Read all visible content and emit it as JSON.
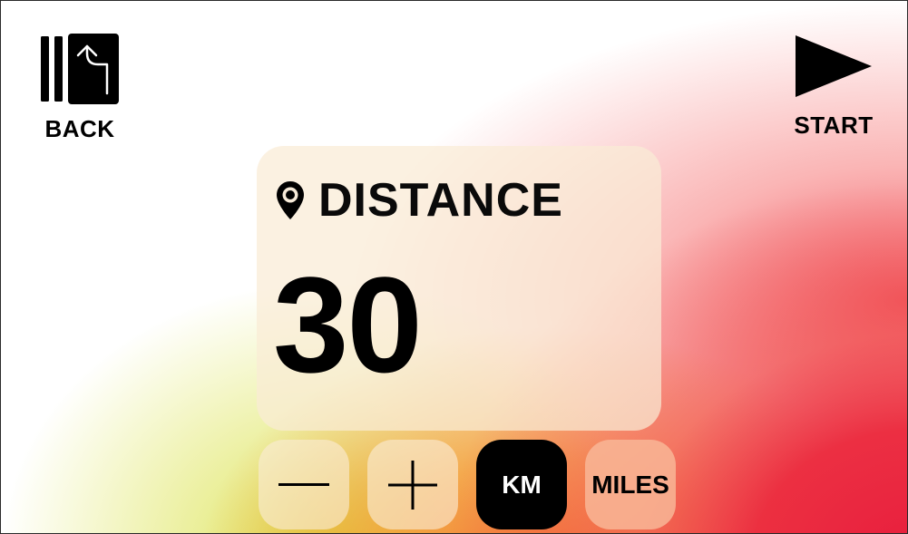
{
  "header": {
    "back_label": "BACK",
    "start_label": "START"
  },
  "metric": {
    "title": "DISTANCE",
    "value": "30"
  },
  "controls": {
    "unit_km": "KM",
    "unit_miles": "MILES",
    "selected_unit": "KM"
  },
  "icons": {
    "back": "back-arrow-icon",
    "start": "play-icon",
    "location": "location-pin-icon",
    "decrement": "minus-icon",
    "increment": "plus-icon"
  },
  "colors": {
    "selected_unit_bg": "#000000",
    "unselected_unit_bg": "#f8b696",
    "card_bg": "#faecd6"
  }
}
